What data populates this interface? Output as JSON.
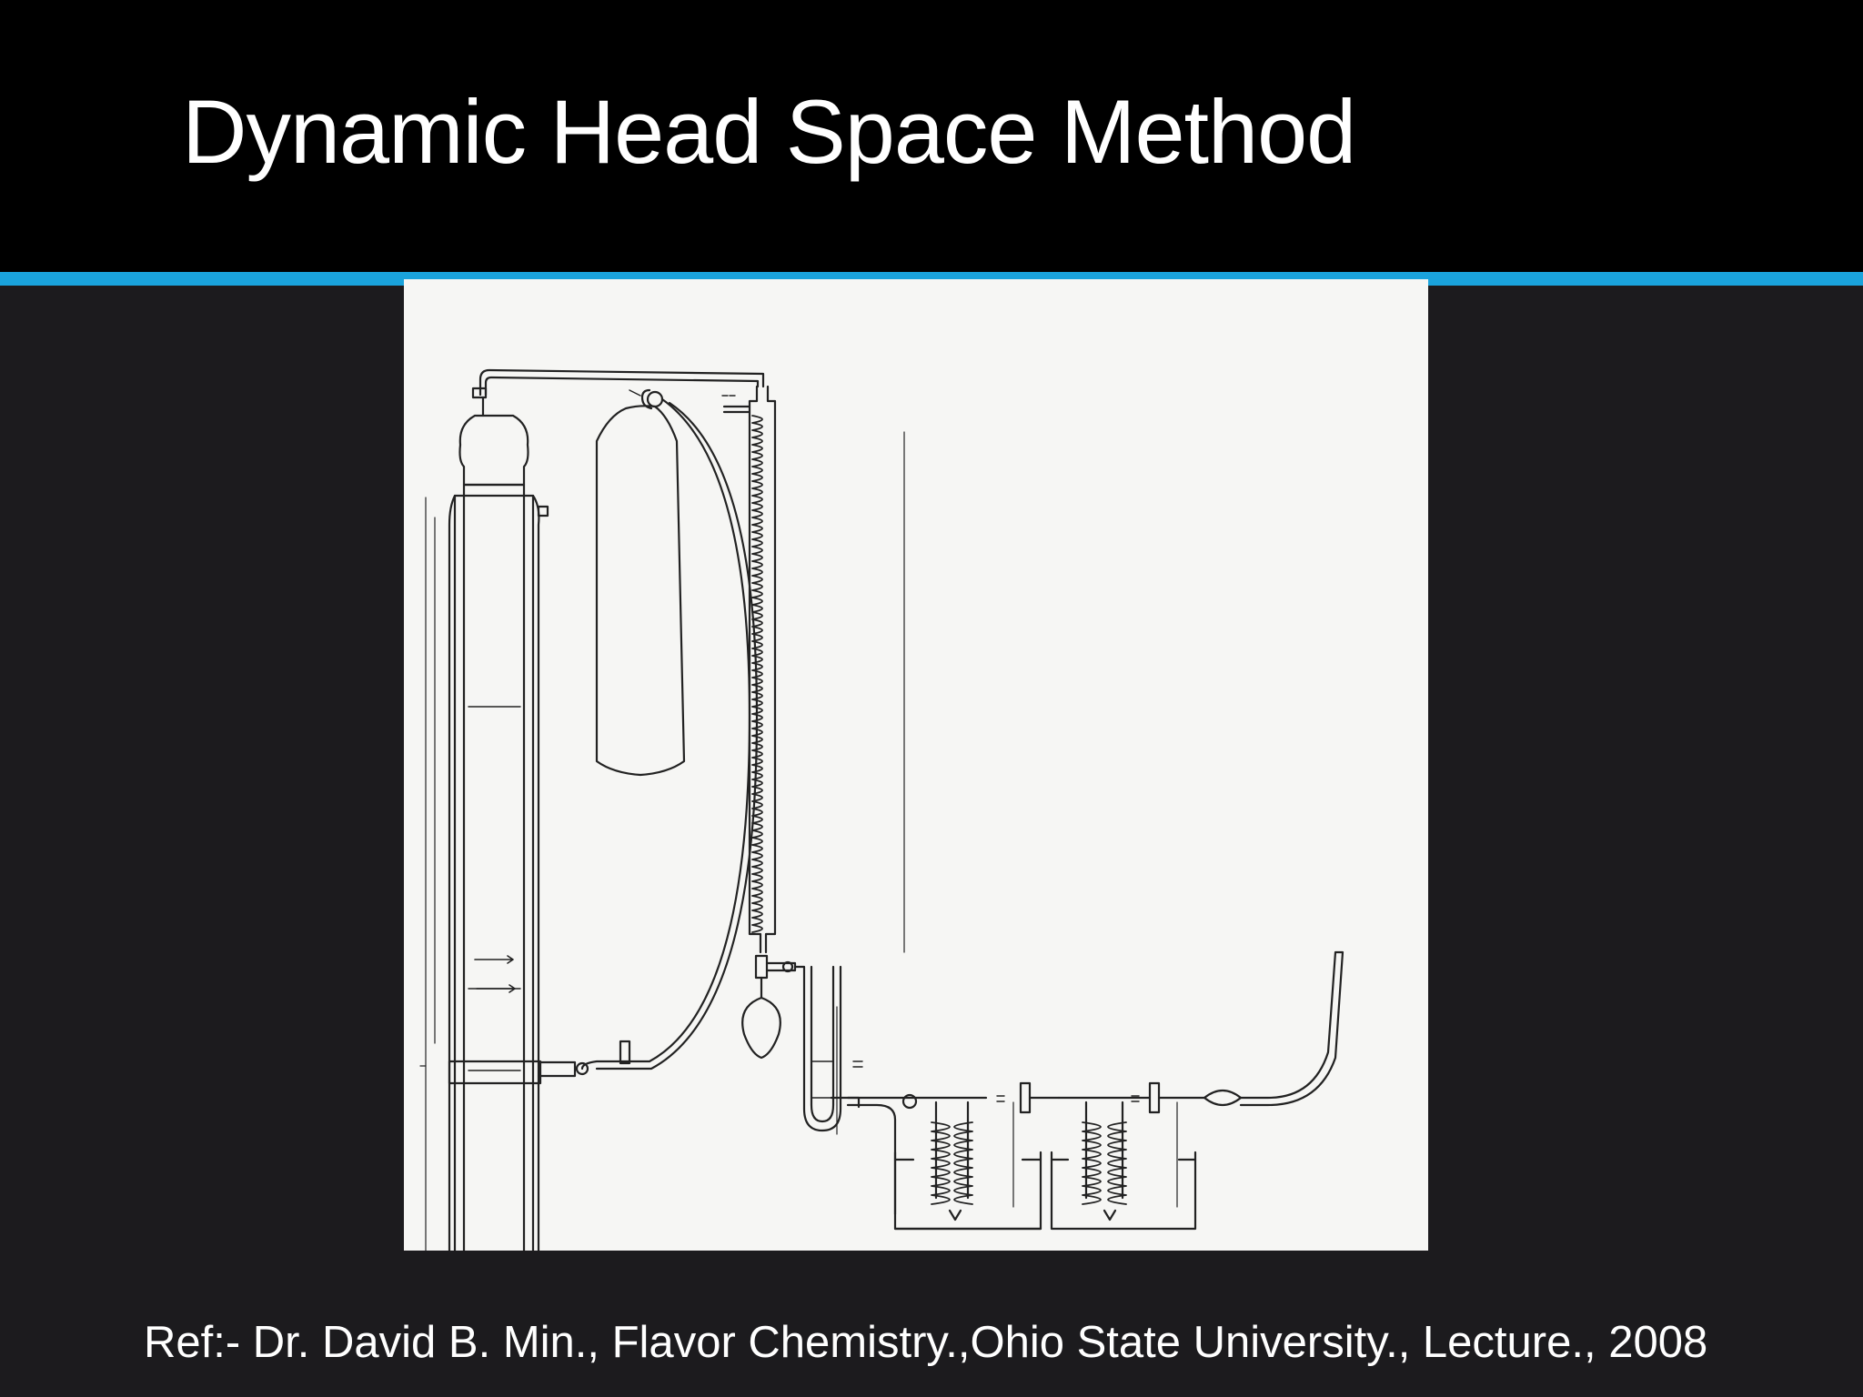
{
  "slide": {
    "title": "Dynamic Head Space Method",
    "reference": "Ref:- Dr. David B. Min., Flavor Chemistry.,Ohio State University., Lecture., 2008"
  },
  "colors": {
    "title_bar": "#000000",
    "accent_line": "#1aa3dc",
    "background": "#1c1b1e",
    "figure_paper": "#f6f6f4",
    "text": "#ffffff"
  }
}
